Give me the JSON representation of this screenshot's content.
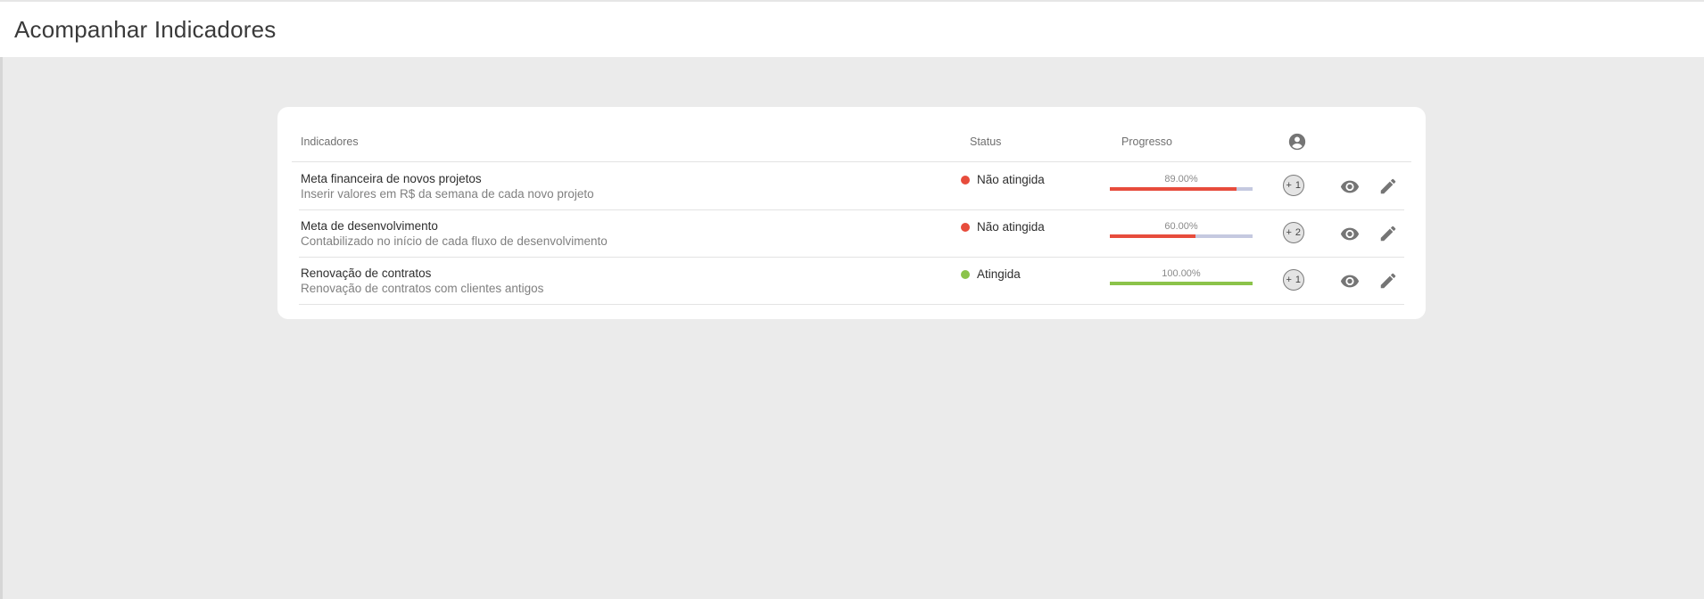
{
  "page": {
    "title": "Acompanhar Indicadores"
  },
  "table": {
    "headers": {
      "indicadores": "Indicadores",
      "status": "Status",
      "progresso": "Progresso",
      "responsaveis_icon": "account-circle-icon"
    },
    "rows": [
      {
        "title": "Meta financeira de novos projetos",
        "description": "Inserir valores em R$ da semana de cada novo projeto",
        "status": "Não atingida",
        "status_color": "#e74c3c",
        "progress_label": "89.00%",
        "progress_value": 0.89,
        "progress_color": "#e74c3c",
        "responsaveis": "+ 1"
      },
      {
        "title": "Meta de desenvolvimento",
        "description": "Contabilizado no início de cada fluxo de desenvolvimento",
        "status": "Não atingida",
        "status_color": "#e74c3c",
        "progress_label": "60.00%",
        "progress_value": 0.6,
        "progress_color": "#e74c3c",
        "responsaveis": "+ 2"
      },
      {
        "title": "Renovação de contratos",
        "description": "Renovação de contratos com clientes antigos",
        "status": "Atingida",
        "status_color": "#8bc34a",
        "progress_label": "100.00%",
        "progress_value": 1.0,
        "progress_color": "#8bc34a",
        "responsaveis": "+ 1"
      }
    ]
  },
  "colors": {
    "background": "#ebebeb",
    "card": "#ffffff",
    "progress_track": "#c5c9e0",
    "icon": "#757575"
  }
}
